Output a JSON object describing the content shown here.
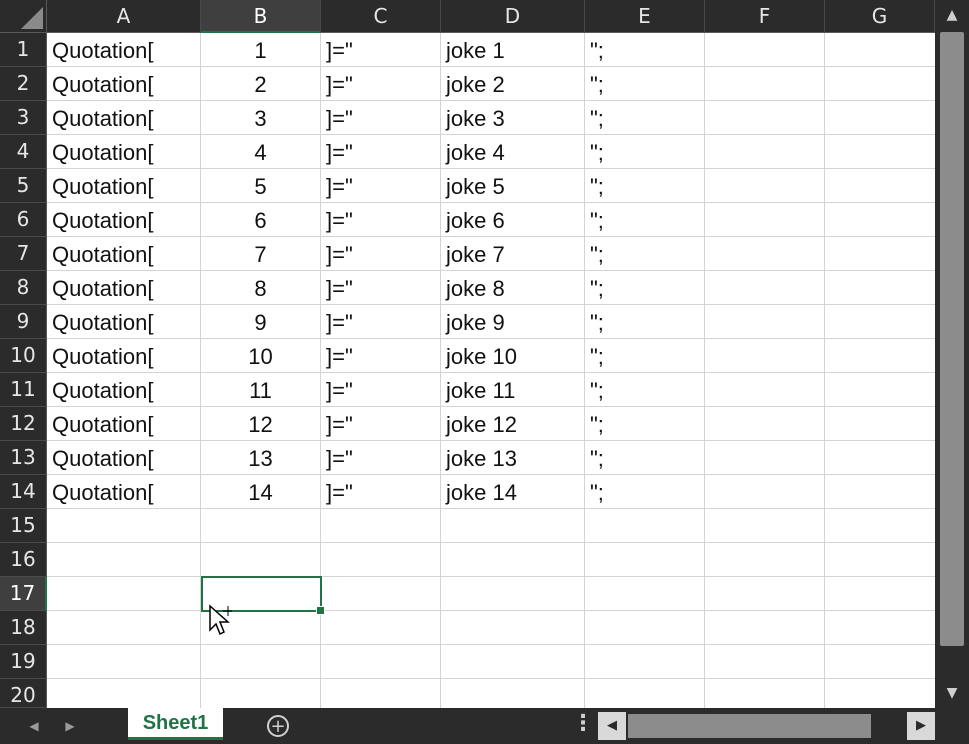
{
  "columns": [
    "A",
    "B",
    "C",
    "D",
    "E",
    "F",
    "G"
  ],
  "selected_column": "B",
  "selected_row": "17",
  "rows": [
    {
      "num": "1",
      "a": "Quotation[",
      "b": "1",
      "c": "]=\"",
      "d": "joke 1",
      "e": "\";"
    },
    {
      "num": "2",
      "a": "Quotation[",
      "b": "2",
      "c": "]=\"",
      "d": "joke 2",
      "e": "\";"
    },
    {
      "num": "3",
      "a": "Quotation[",
      "b": "3",
      "c": "]=\"",
      "d": "joke 3",
      "e": "\";"
    },
    {
      "num": "4",
      "a": "Quotation[",
      "b": "4",
      "c": "]=\"",
      "d": "joke 4",
      "e": "\";"
    },
    {
      "num": "5",
      "a": "Quotation[",
      "b": "5",
      "c": "]=\"",
      "d": "joke 5",
      "e": "\";"
    },
    {
      "num": "6",
      "a": "Quotation[",
      "b": "6",
      "c": "]=\"",
      "d": "joke 6",
      "e": "\";"
    },
    {
      "num": "7",
      "a": "Quotation[",
      "b": "7",
      "c": "]=\"",
      "d": "joke 7",
      "e": "\";"
    },
    {
      "num": "8",
      "a": "Quotation[",
      "b": "8",
      "c": "]=\"",
      "d": "joke 8",
      "e": "\";"
    },
    {
      "num": "9",
      "a": "Quotation[",
      "b": "9",
      "c": "]=\"",
      "d": "joke 9",
      "e": "\";"
    },
    {
      "num": "10",
      "a": "Quotation[",
      "b": "10",
      "c": "]=\"",
      "d": "joke 10",
      "e": "\";"
    },
    {
      "num": "11",
      "a": "Quotation[",
      "b": "11",
      "c": "]=\"",
      "d": "joke 11",
      "e": "\";"
    },
    {
      "num": "12",
      "a": "Quotation[",
      "b": "12",
      "c": "]=\"",
      "d": "joke 12",
      "e": "\";"
    },
    {
      "num": "13",
      "a": "Quotation[",
      "b": "13",
      "c": "]=\"",
      "d": "joke 13",
      "e": "\";"
    },
    {
      "num": "14",
      "a": "Quotation[",
      "b": "14",
      "c": "]=\"",
      "d": "joke 14",
      "e": "\";"
    },
    {
      "num": "15",
      "a": "",
      "b": "",
      "c": "",
      "d": "",
      "e": ""
    },
    {
      "num": "16",
      "a": "",
      "b": "",
      "c": "",
      "d": "",
      "e": ""
    },
    {
      "num": "17",
      "a": "",
      "b": "",
      "c": "",
      "d": "",
      "e": ""
    },
    {
      "num": "18",
      "a": "",
      "b": "",
      "c": "",
      "d": "",
      "e": ""
    },
    {
      "num": "19",
      "a": "",
      "b": "",
      "c": "",
      "d": "",
      "e": ""
    },
    {
      "num": "20",
      "a": "",
      "b": "",
      "c": "",
      "d": "",
      "e": ""
    }
  ],
  "sheet_tab": "Sheet1",
  "icons": {
    "add_sheet": "plus-circle-icon",
    "more": "vertical-ellipsis-icon",
    "scroll_up": "triangle-up-icon",
    "scroll_down": "triangle-down-icon",
    "scroll_left": "triangle-left-icon",
    "scroll_right": "triangle-right-icon",
    "nav_prev": "chevron-left-icon",
    "nav_next": "chevron-right-icon"
  },
  "colors": {
    "accent": "#217346",
    "header_bg": "#2b2b2b",
    "grid_line": "#d4d4d4"
  }
}
